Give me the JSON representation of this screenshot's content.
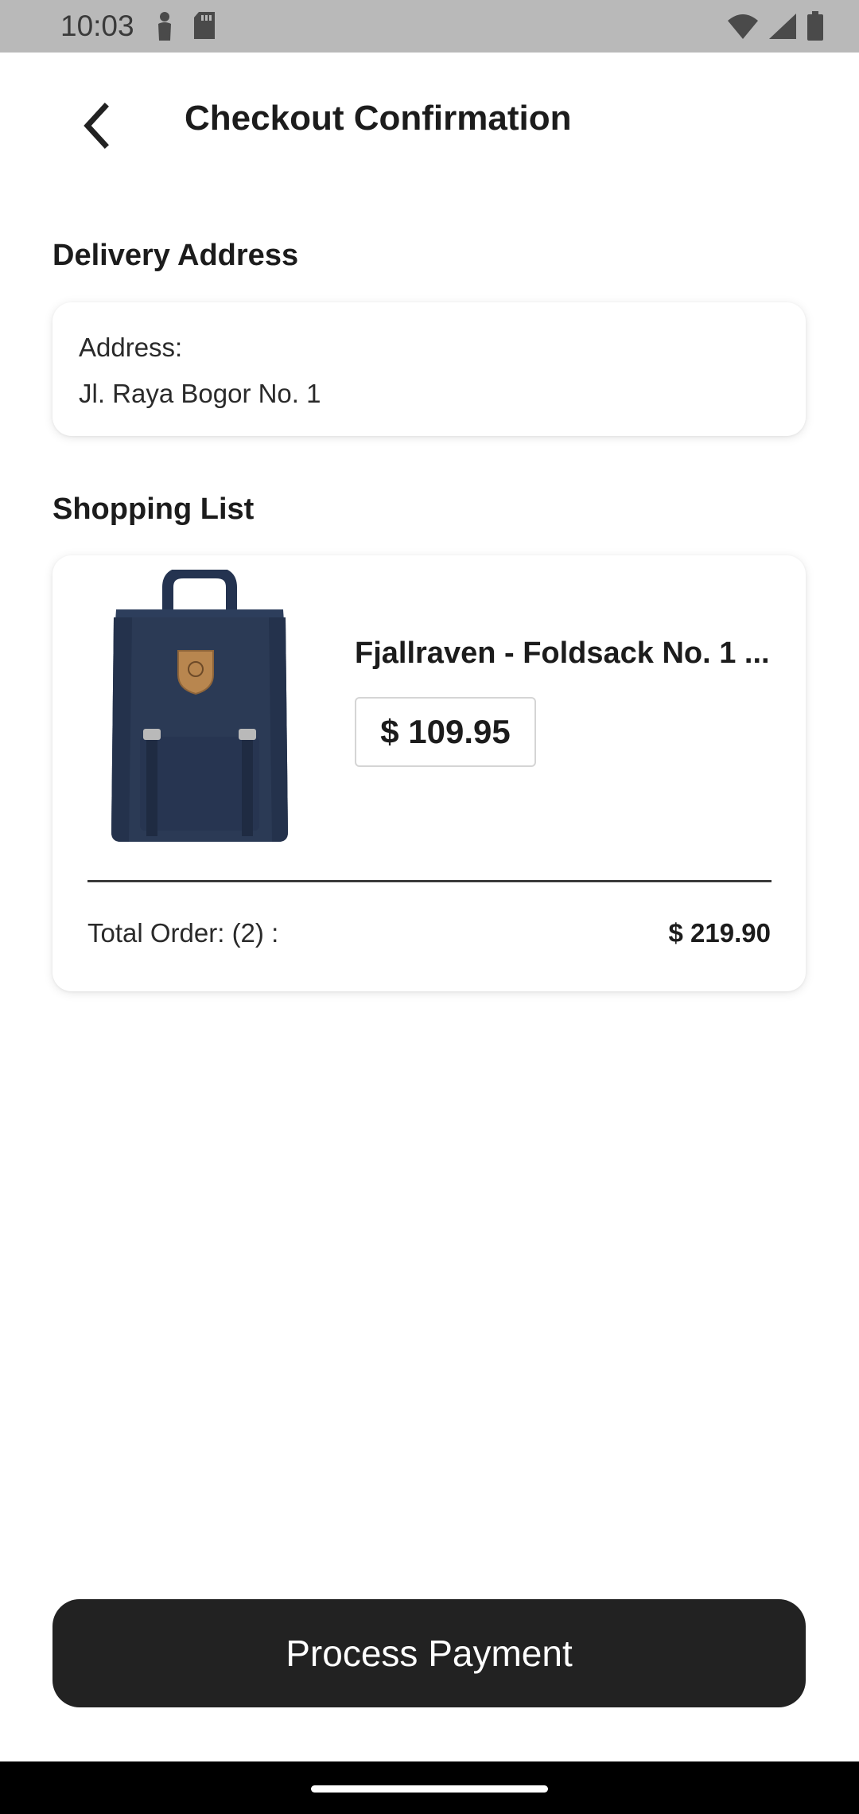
{
  "status_bar": {
    "time": "10:03",
    "icons": [
      "person-icon",
      "sd-card-icon",
      "wifi-icon",
      "signal-icon",
      "battery-icon"
    ]
  },
  "header": {
    "title": "Checkout Confirmation",
    "back_icon": "back-arrow-icon"
  },
  "delivery": {
    "section_title": "Delivery Address",
    "label": "Address:",
    "value": "Jl. Raya Bogor No. 1"
  },
  "shopping": {
    "section_title": "Shopping List",
    "items": [
      {
        "name": "Fjallraven - Foldsack No. 1 ...",
        "price": "$ 109.95",
        "image_icon": "backpack-image"
      }
    ],
    "total_label": "Total Order: (2) :",
    "total_value": "$ 219.90"
  },
  "actions": {
    "pay_label": "Process Payment"
  },
  "colors": {
    "status_bar_bg": "#b9b9b9",
    "button_bg": "#222222",
    "product_navy": "#2b3a55",
    "logo_tan": "#b8864f"
  }
}
